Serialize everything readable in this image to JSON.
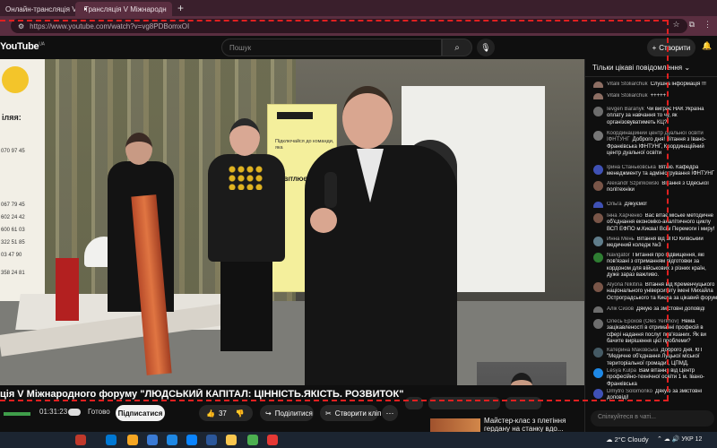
{
  "browser": {
    "tabs": [
      {
        "label": "Онлайн-трансляція V Міжн",
        "active": false
      },
      {
        "label": "Трансляція V Міжнародн",
        "active": true
      }
    ],
    "new_tab": "+",
    "url": "https://www.youtube.com/watch?v=vg8PDBomxOI"
  },
  "youtube": {
    "logo": "YouTube",
    "logo_sup": "UA",
    "search_placeholder": "Пошук",
    "create_label": "Створити"
  },
  "video": {
    "title": "ція V Міжнародного форуму \"ЛЮДСЬКИЙ КАПІТАЛ: ЦІННІСТЬ.ЯКІСТЬ. РОЗВИТОК\"",
    "time": "01:31:23",
    "ready": "Готово",
    "subscribe": "Підписатися",
    "likes": "37",
    "share": "Поділитися",
    "clip": "Створити кліп",
    "poster_left_text": "іляя:",
    "poster_phones": [
      "070 97 45",
      "067 79 45",
      "602 24 42",
      "600 61 03",
      "322 51 85",
      "03 47 90",
      "358 24 81"
    ],
    "banner_text_small": "Підключайся до команди, яка",
    "banner_text_big": "ОСВІТЛЮЄ ЖИТТЯ!"
  },
  "recommendation": {
    "title": "Майстер-клас з плетіння",
    "subtitle": "гердану на станку вдо..."
  },
  "chat": {
    "header": "Тільки цікаві повідомлення",
    "messages": [
      {
        "author": "Vitalii Stoliarchuk",
        "text": "Слушна інформація !!!",
        "color": "#8d6e63"
      },
      {
        "author": "Vitalii Stoliarchuk",
        "text": "+++++",
        "color": "#8d6e63"
      },
      {
        "author": "Ievgen Baranyk",
        "text": "Чи виграє НАК Україна оплату за навчання то чу, як організовуватиметь КЦ?",
        "color": "#6d6d6d"
      },
      {
        "author": "Координаційний центр дуальної освіти ІФНТУНГ",
        "text": "Доброго дня! Вітання з Івано-Франківська ІФНТУНГ, Координаційний центр дуальної освіти",
        "color": "#777777"
      },
      {
        "author": "Ірина Станьковська",
        "text": "Вітаю. Кафедра менеджменту та адміністрування ІФНТУНГ",
        "color": "#3f51b5"
      },
      {
        "author": "Alexandr Szpinkowski",
        "text": "Вітання з Одеської політехніки",
        "color": "#795548"
      },
      {
        "author": "Ольга",
        "text": "Дякуємо!",
        "color": "#3f51b5"
      },
      {
        "author": "Інна Харченко",
        "text": "Вас вітає міське методичне об'єднання економіко-аналітичного циклу ВСП ЕФПО м.Києва! Всім Перемоги і миру!",
        "color": "#795548"
      },
      {
        "author": "Инна Мень",
        "text": "Вітання від ЗПО Київський медичний коледж №3",
        "color": "#607d8b"
      },
      {
        "author": "Navigator",
        "text": "Питання про підвищення, які пов'язані з отриманням підготовки за кордоном для військових з різних країн, дуже зараз важливо.",
        "color": "#2e7d32"
      },
      {
        "author": "Alyona Nikitina",
        "text": "Вітання від Кременчуцького національного університету імені Михайла Остроградського та Києва за цікавий форум",
        "color": "#795548"
      },
      {
        "author": "Алік Сизов",
        "text": "Дякую за змістовні доповіді",
        "color": "#6d6d6d"
      },
      {
        "author": "Олесь Ерохов (Oles Yerkhov)",
        "text": "Нема зацікавленості в отриманні професій в сфері надання послуг пов'язаних. Як ви бачите вирішення цієї проблеми?",
        "color": "#6d6d6d"
      },
      {
        "author": "Катерина Маковська",
        "text": "Доброго дня. КП \"Медичне об'єднання Луцької міської територіальної громади\", ЦПМД.",
        "color": "#455a64"
      },
      {
        "author": "Lesya Kulpa",
        "text": "Вам вітання від Центр професійно-технічної освіти 1 м. Івано-Франківська",
        "color": "#1e88e5"
      },
      {
        "author": "Dmytro Solomonko",
        "text": "Дякую за змістовні доповіді!",
        "color": "#3f51b5"
      }
    ],
    "input_placeholder": "Спілкуйтеся в чаті..."
  },
  "taskbar": {
    "weather": "2°C Cloudy",
    "lang": "УКР",
    "clock": "12"
  }
}
